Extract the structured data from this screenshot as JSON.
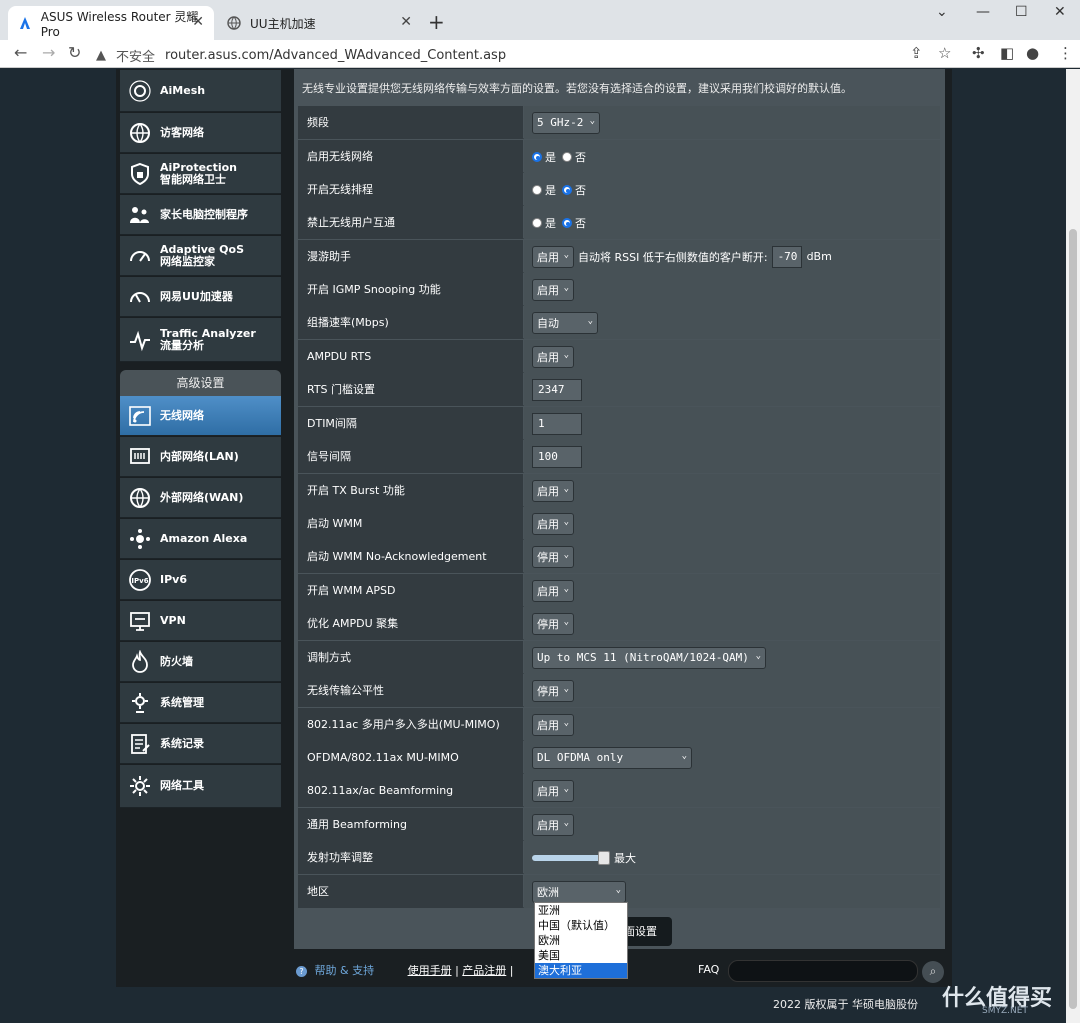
{
  "browser": {
    "tabs": [
      {
        "title": "ASUS Wireless Router 灵耀Pro",
        "active": true
      },
      {
        "title": "UU主机加速",
        "active": false
      }
    ],
    "security_label": "不安全",
    "url": "router.asus.com/Advanced_WAdvanced_Content.asp"
  },
  "sidebar": {
    "top_items": [
      {
        "label1": "AiMesh",
        "label2": ""
      },
      {
        "label1": "访客网络",
        "label2": ""
      },
      {
        "label1": "AiProtection",
        "label2": "智能网络卫士"
      },
      {
        "label1": "家长电脑控制程序",
        "label2": ""
      },
      {
        "label1": "Adaptive QoS",
        "label2": "网络监控家"
      },
      {
        "label1": "网易UU加速器",
        "label2": ""
      },
      {
        "label1": "Traffic Analyzer",
        "label2": "流量分析"
      }
    ],
    "section_header": "高级设置",
    "advanced_items": [
      {
        "label": "无线网络",
        "active": true
      },
      {
        "label": "内部网络(LAN)"
      },
      {
        "label": "外部网络(WAN)"
      },
      {
        "label": "Amazon Alexa"
      },
      {
        "label": "IPv6"
      },
      {
        "label": "VPN"
      },
      {
        "label": "防火墙"
      },
      {
        "label": "系统管理"
      },
      {
        "label": "系统记录"
      },
      {
        "label": "网络工具"
      }
    ]
  },
  "main": {
    "description": "无线专业设置提供您无线网络传输与效率方面的设置。若您没有选择适合的设置，建议采用我们校调好的默认值。",
    "settings": {
      "band": {
        "label": "频段",
        "value": "5 GHz-2"
      },
      "enable_wireless": {
        "label": "启用无线网络",
        "yes": "是",
        "no": "否",
        "selected": "yes"
      },
      "wireless_schedule": {
        "label": "开启无线排程",
        "yes": "是",
        "no": "否",
        "selected": "no"
      },
      "ap_isolation": {
        "label": "禁止无线用户互通",
        "yes": "是",
        "no": "否",
        "selected": "no"
      },
      "roaming": {
        "label": "漫游助手",
        "value": "启用",
        "text1": "自动将 RSSI 低于右侧数值的客户断开:",
        "rssi": "-70",
        "unit": "dBm"
      },
      "igmp": {
        "label": "开启 IGMP Snooping 功能",
        "value": "启用"
      },
      "multicast_rate": {
        "label": "组播速率(Mbps)",
        "value": "自动"
      },
      "ampdu_rts": {
        "label": "AMPDU RTS",
        "value": "启用"
      },
      "rts_threshold": {
        "label": "RTS 门槛设置",
        "value": "2347"
      },
      "dtim": {
        "label": "DTIM间隔",
        "value": "1"
      },
      "beacon": {
        "label": "信号间隔",
        "value": "100"
      },
      "tx_burst": {
        "label": "开启 TX Burst 功能",
        "value": "启用"
      },
      "wmm": {
        "label": "启动 WMM",
        "value": "启用"
      },
      "wmm_noack": {
        "label": "启动 WMM No-Acknowledgement",
        "value": "停用"
      },
      "wmm_apsd": {
        "label": "开启 WMM APSD",
        "value": "启用"
      },
      "ampdu_agg": {
        "label": "优化 AMPDU 聚集",
        "value": "停用"
      },
      "modulation": {
        "label": "调制方式",
        "value": "Up to MCS 11 (NitroQAM/1024-QAM)"
      },
      "airtime_fairness": {
        "label": "无线传输公平性",
        "value": "停用"
      },
      "mumimo_ac": {
        "label": "802.11ac 多用户多入多出(MU-MIMO)",
        "value": "启用"
      },
      "ofdma": {
        "label": "OFDMA/802.11ax MU-MIMO",
        "value": "DL OFDMA only"
      },
      "beamforming_ax": {
        "label": "802.11ax/ac Beamforming",
        "value": "启用"
      },
      "beamforming_universal": {
        "label": "通用 Beamforming",
        "value": "启用"
      },
      "tx_power": {
        "label": "发射功率调整",
        "value_text": "最大",
        "level": 1.0
      },
      "region": {
        "label": "地区",
        "value": "欧洲"
      }
    },
    "region_options": [
      "亚洲",
      "中国（默认值）",
      "欧洲",
      "美国",
      "澳大利亚"
    ],
    "region_highlighted": "澳大利亚",
    "apply_button": "面设置"
  },
  "footer": {
    "help": "帮助 & 支持",
    "manual": "使用手册",
    "register": "产品注册",
    "faq": "FAQ",
    "copyright": "2022 版权属于 华硕电脑股份"
  },
  "watermark": {
    "big": "什么值得买",
    "small": "SMYZ.NET"
  }
}
